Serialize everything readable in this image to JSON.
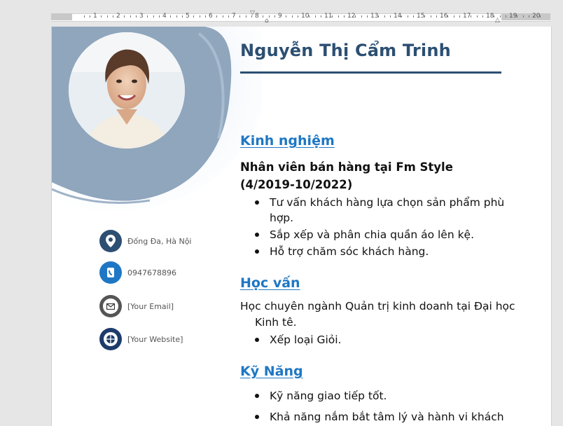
{
  "ruler": {
    "numbers": [
      "1",
      "2",
      "3",
      "4",
      "5",
      "6",
      "7",
      "8",
      "9",
      "10",
      "11",
      "12",
      "13",
      "14",
      "15",
      "16",
      "17",
      "18",
      "19",
      "20"
    ]
  },
  "resume": {
    "name": "Nguyễn Thị Cẩm Trinh",
    "contacts": [
      {
        "icon": "location-pin-icon",
        "text": "Đống Đa, Hà Nội",
        "color": "#2c4f72"
      },
      {
        "icon": "phone-icon",
        "text": "0947678896",
        "color": "#1e77c4"
      },
      {
        "icon": "email-icon",
        "text": "[Your Email]",
        "color": "#555555"
      },
      {
        "icon": "globe-icon",
        "text": "[Your Website]",
        "color": "#1d3c6b"
      }
    ],
    "experience": {
      "heading": "Kinh nghiệm",
      "job_title": "Nhân viên bán hàng tại Fm Style  (4/2019-10/2022)",
      "bullets": [
        "Tư vấn khách hàng lựa chọn sản phẩm phù hợp.",
        "Sắp xếp và phân chia quần áo lên kệ.",
        "Hỗ trợ chăm sóc khách hàng."
      ]
    },
    "education": {
      "heading": "Học vấn",
      "text": "Học chuyên ngành Quản trị kinh doanh tại Đại học Kinh tê.",
      "bullets": [
        "Xếp loại Giỏi."
      ]
    },
    "skills": {
      "heading": "Kỹ Năng",
      "bullets": [
        "Kỹ năng giao tiếp tốt.",
        "Khả năng nắm bắt tâm lý và hành vi khách"
      ]
    }
  },
  "colors": {
    "accent": "#1e77c4",
    "name": "#2c4f72",
    "brush": "#8fa6bd"
  }
}
